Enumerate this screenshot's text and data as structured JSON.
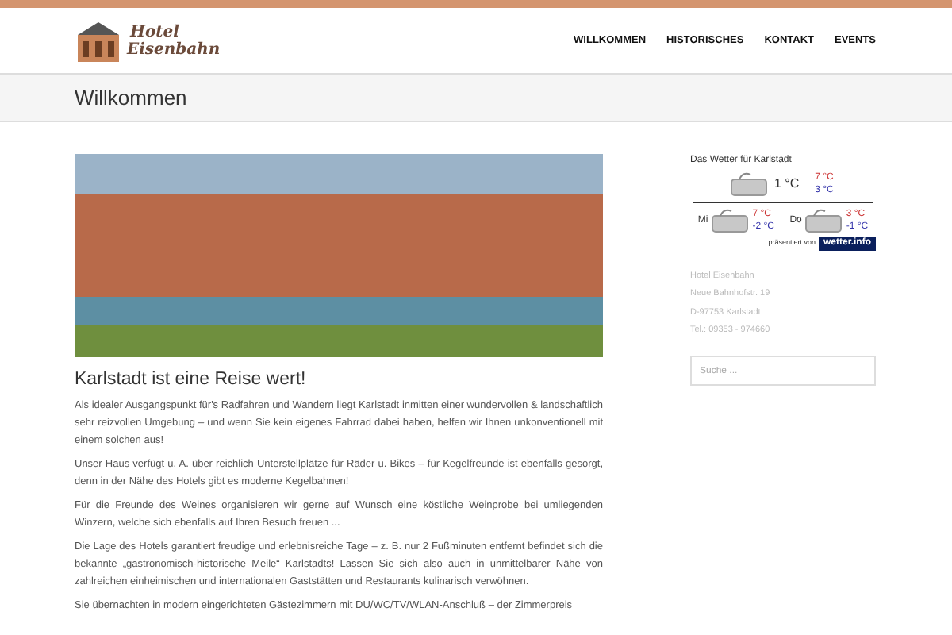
{
  "header": {
    "logo": {
      "line1": "Hotel",
      "line2": "Eisenbahn"
    },
    "nav": [
      {
        "label": "WILLKOMMEN"
      },
      {
        "label": "HISTORISCHES"
      },
      {
        "label": "KONTAKT"
      },
      {
        "label": "EVENTS"
      }
    ]
  },
  "page_title": "Willkommen",
  "article": {
    "heading": "Karlstadt ist eine Reise wert!",
    "paragraphs": [
      "Als idealer Ausgangspunkt für's Radfahren und Wandern liegt Karlstadt inmitten einer wundervollen & landschaftlich sehr reizvollen Umgebung – und wenn Sie kein eigenes Fahrrad dabei haben, helfen wir Ihnen unkonventionell mit einem solchen aus!",
      "Unser Haus  verfügt u. A. über reichlich Unterstellplätze für Räder u. Bikes – für Kegelfreunde ist ebenfalls gesorgt, denn in der Nähe des Hotels gibt es moderne Kegelbahnen!",
      "Für die Freunde des Weines organisieren wir gerne auf Wunsch eine köstliche Weinprobe bei umliegenden Winzern, welche sich ebenfalls auf Ihren Besuch freuen ...",
      "Die Lage des Hotels garantiert freudige und erlebnisreiche Tage – z. B. nur 2 Fußminuten entfernt befindet sich die bekannte „gastronomisch-historische Meile“ Karlstadts! Lassen Sie sich also auch in unmittelbarer Nähe von zahlreichen einheimischen und internationalen Gaststätten und Restaurants kulinarisch verwöhnen.",
      "Sie übernachten in modern eingerichteten Gästezimmern mit DU/WC/TV/WLAN-Anschluß – der Zimmerpreis"
    ]
  },
  "sidebar": {
    "weather": {
      "title": "Das Wetter für Karlstadt",
      "today": {
        "temp": "1 °C",
        "high": "7 °C",
        "low": "3 °C"
      },
      "days": [
        {
          "day": "Mi",
          "high": "7 °C",
          "low": "-2 °C"
        },
        {
          "day": "Do",
          "high": "3 °C",
          "low": "-1 °C"
        }
      ],
      "credit": "präsentiert von",
      "logo": "wetter.info"
    },
    "address": [
      "Hotel Eisenbahn",
      "Neue Bahnhofstr. 19",
      "D-97753 Karlstadt",
      "Tel.: 09353 - 974660"
    ],
    "search": {
      "placeholder": "Suche ..."
    }
  }
}
